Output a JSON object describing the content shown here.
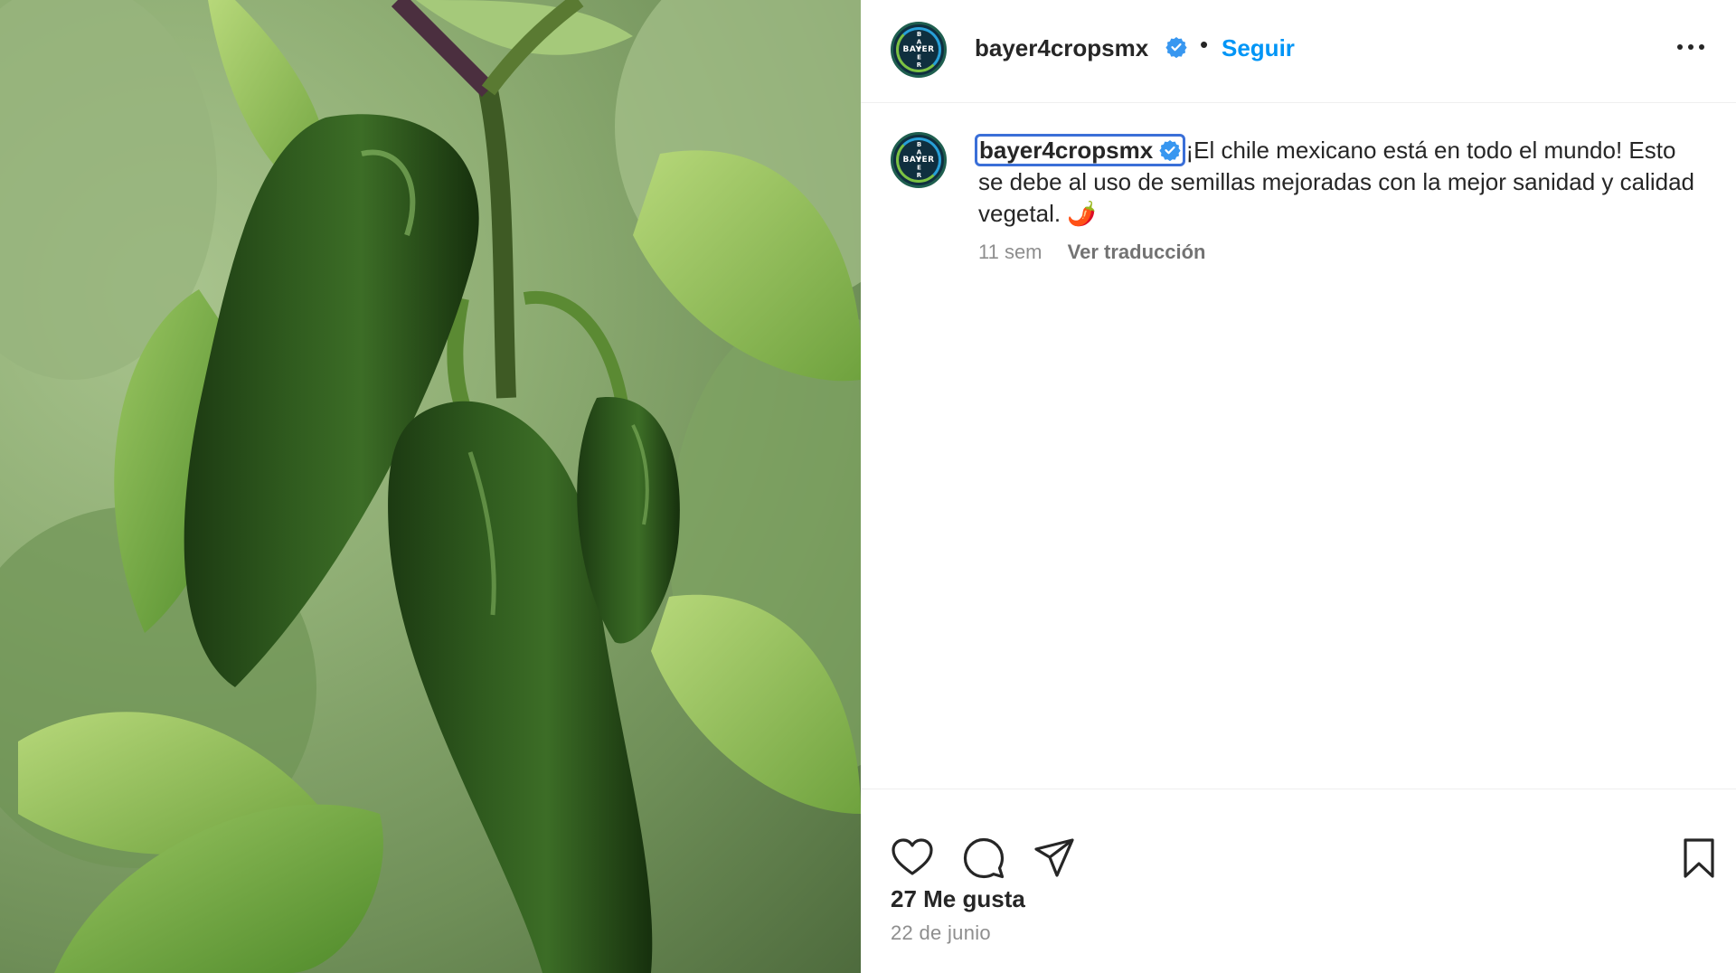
{
  "post": {
    "username": "bayer4cropsmx",
    "verified": true,
    "dot": "•",
    "follow_label": "Seguir",
    "avatar_text": "BAYER",
    "more_icon": "more-horizontal-icon"
  },
  "caption": {
    "username": "bayer4cropsmx",
    "text": "¡El chile mexicano está en todo el mundo! Esto se debe al uso de semillas mejoradas con la mejor sanidad y calidad vegetal. 🌶️",
    "time_ago": "11 sem",
    "translate_label": "Ver traducción"
  },
  "actions": {
    "like_icon": "heart-icon",
    "comment_icon": "comment-icon",
    "share_icon": "send-icon",
    "save_icon": "bookmark-icon"
  },
  "stats": {
    "likes": "27 Me gusta",
    "date": "22 de junio"
  },
  "colors": {
    "link": "#0095f6",
    "verified": "#3897f0",
    "text": "#262626",
    "muted": "#8e8e8e"
  }
}
